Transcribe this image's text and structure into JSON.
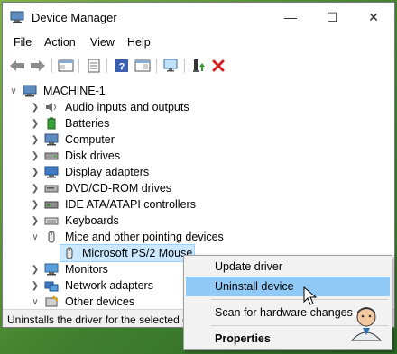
{
  "window": {
    "title": "Device Manager",
    "controls": {
      "minimize": "—",
      "maximize": "☐",
      "close": "✕"
    }
  },
  "menu": [
    "File",
    "Action",
    "View",
    "Help"
  ],
  "tree": {
    "root": "MACHINE-1",
    "categories": [
      "Audio inputs and outputs",
      "Batteries",
      "Computer",
      "Disk drives",
      "Display adapters",
      "DVD/CD-ROM drives",
      "IDE ATA/ATAPI controllers",
      "Keyboards",
      "Mice and other pointing devices",
      "Microsoft PS/2 Mouse",
      "Monitors",
      "Network adapters",
      "Other devices"
    ]
  },
  "status": "Uninstalls the driver for the selected d",
  "context_menu": {
    "update": "Update driver",
    "uninstall": "Uninstall device",
    "scan": "Scan for hardware changes",
    "properties": "Properties"
  },
  "colors": {
    "highlight": "#91c9f7",
    "selection": "#cce8ff",
    "accent_red": "#d21f1f"
  }
}
